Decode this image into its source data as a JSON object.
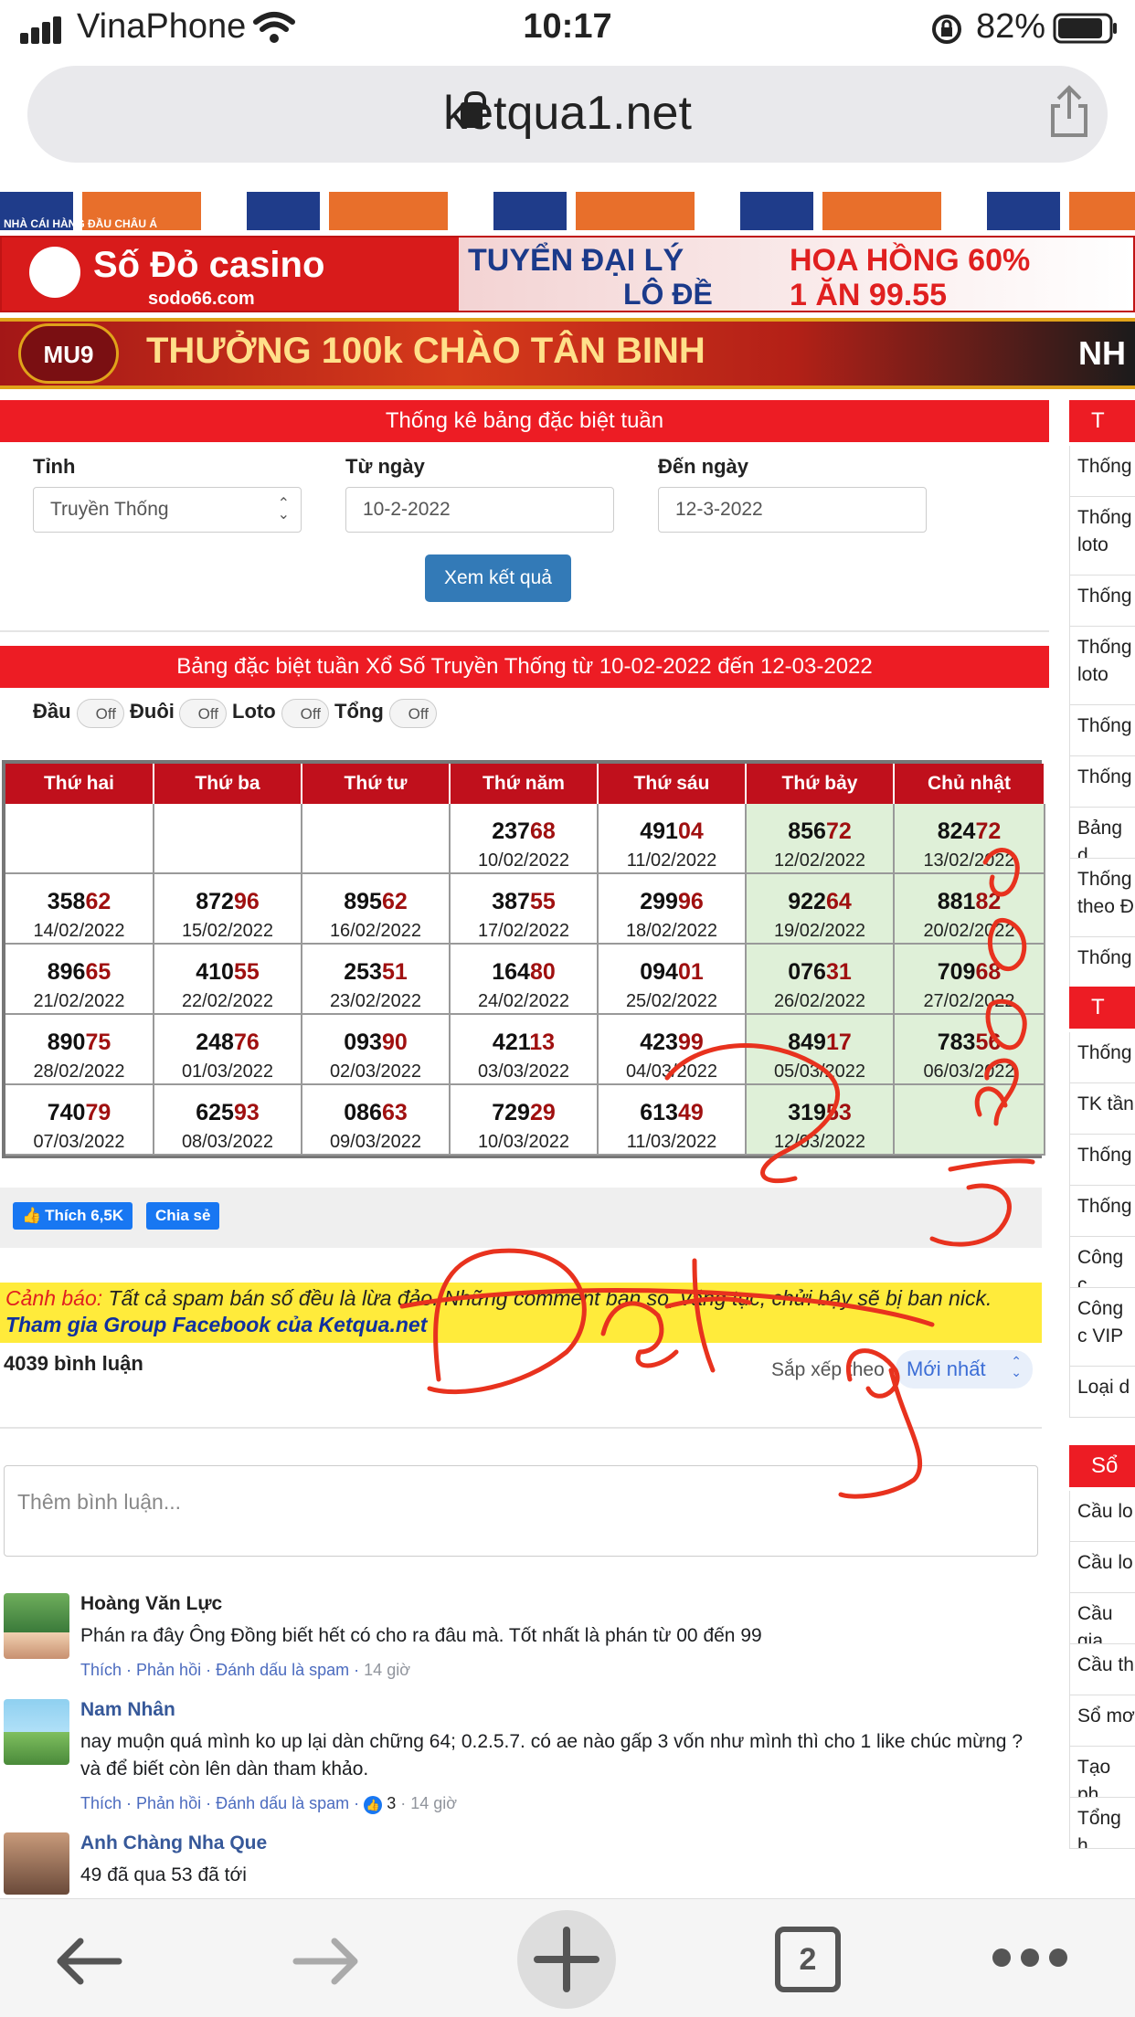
{
  "status_bar": {
    "carrier": "VinaPhone",
    "time": "10:17",
    "battery": "82%"
  },
  "browser": {
    "url": "ketqua1.net",
    "tab_count": "2"
  },
  "banners": {
    "b1_text": "NHÀ CÁI HÀNG ĐẦU CHÂU Á",
    "b2_brand": "Số Đỏ casino",
    "b2_site": "sodo66.com",
    "b2_line1": "TUYỂN ĐẠI LÝ",
    "b2_line2": "LÔ ĐỀ",
    "b2_line3": "HOA HỒNG 60%",
    "b2_line4": "1 ĂN 99.55",
    "b3_brand": "MU9",
    "b3_text": "THƯỞNG 100k CHÀO TÂN BINH",
    "b3_tail": "NH"
  },
  "filter": {
    "title": "Thống kê bảng đặc biệt tuần",
    "province_label": "Tỉnh",
    "province_value": "Truyền Thống",
    "from_label": "Từ ngày",
    "from_value": "10-2-2022",
    "to_label": "Đến ngày",
    "to_value": "12-3-2022",
    "submit": "Xem kết quả"
  },
  "results": {
    "title": "Bảng đặc biệt tuần Xổ Số Truyền Thống từ 10-02-2022 đến 12-03-2022",
    "toggles": [
      {
        "label": "Đầu",
        "state": "Off"
      },
      {
        "label": "Đuôi",
        "state": "Off"
      },
      {
        "label": "Loto",
        "state": "Off"
      },
      {
        "label": "Tổng",
        "state": "Off"
      }
    ],
    "headers": [
      "Thứ hai",
      "Thứ ba",
      "Thứ tư",
      "Thứ năm",
      "Thứ sáu",
      "Thứ bảy",
      "Chủ nhật"
    ],
    "rows": [
      [
        {
          "a": "",
          "b": "",
          "d": ""
        },
        {
          "a": "",
          "b": "",
          "d": ""
        },
        {
          "a": "",
          "b": "",
          "d": ""
        },
        {
          "a": "237",
          "b": "68",
          "d": "10/02/2022"
        },
        {
          "a": "491",
          "b": "04",
          "d": "11/02/2022"
        },
        {
          "a": "856",
          "b": "72",
          "d": "12/02/2022"
        },
        {
          "a": "824",
          "b": "72",
          "d": "13/02/2022"
        }
      ],
      [
        {
          "a": "358",
          "b": "62",
          "d": "14/02/2022"
        },
        {
          "a": "872",
          "b": "96",
          "d": "15/02/2022"
        },
        {
          "a": "895",
          "b": "62",
          "d": "16/02/2022"
        },
        {
          "a": "387",
          "b": "55",
          "d": "17/02/2022"
        },
        {
          "a": "299",
          "b": "96",
          "d": "18/02/2022"
        },
        {
          "a": "922",
          "b": "64",
          "d": "19/02/2022"
        },
        {
          "a": "881",
          "b": "82",
          "d": "20/02/2022"
        }
      ],
      [
        {
          "a": "896",
          "b": "65",
          "d": "21/02/2022"
        },
        {
          "a": "410",
          "b": "55",
          "d": "22/02/2022"
        },
        {
          "a": "253",
          "b": "51",
          "d": "23/02/2022"
        },
        {
          "a": "164",
          "b": "80",
          "d": "24/02/2022"
        },
        {
          "a": "094",
          "b": "01",
          "d": "25/02/2022"
        },
        {
          "a": "076",
          "b": "31",
          "d": "26/02/2022"
        },
        {
          "a": "709",
          "b": "68",
          "d": "27/02/2022"
        }
      ],
      [
        {
          "a": "890",
          "b": "75",
          "d": "28/02/2022"
        },
        {
          "a": "248",
          "b": "76",
          "d": "01/03/2022"
        },
        {
          "a": "093",
          "b": "90",
          "d": "02/03/2022"
        },
        {
          "a": "421",
          "b": "13",
          "d": "03/03/2022"
        },
        {
          "a": "423",
          "b": "99",
          "d": "04/03/2022"
        },
        {
          "a": "849",
          "b": "17",
          "d": "05/03/2022"
        },
        {
          "a": "783",
          "b": "56",
          "d": "06/03/2022"
        }
      ],
      [
        {
          "a": "740",
          "b": "79",
          "d": "07/03/2022"
        },
        {
          "a": "625",
          "b": "93",
          "d": "08/03/2022"
        },
        {
          "a": "086",
          "b": "63",
          "d": "09/03/2022"
        },
        {
          "a": "729",
          "b": "29",
          "d": "10/03/2022"
        },
        {
          "a": "613",
          "b": "49",
          "d": "11/03/2022"
        },
        {
          "a": "319",
          "b": "53",
          "d": "12/03/2022"
        },
        {
          "a": "",
          "b": "",
          "d": ""
        }
      ]
    ]
  },
  "social": {
    "like": "Thích 6,5K",
    "share": "Chia sẻ"
  },
  "warning": {
    "head": "Cảnh báo:",
    "text": " Tất cả spam bán số đều là lừa đảo. Những comment bán số, văng tục, chửi bậy sẽ bị ban nick.",
    "link": "Tham gia Group Facebook của Ketqua.net"
  },
  "comments": {
    "count": "4039 bình luận",
    "sort_label": "Sắp xếp theo",
    "sort_value": "Mới nhất",
    "placeholder": "Thêm bình luận...",
    "items": [
      {
        "name": "Hoàng Văn Lực",
        "text": "Phán ra đây Ông Đồng biết hết có cho ra đâu mà. Tốt nhất là phán từ 00 đến 99",
        "actions": "Thích · Phản hồi · Đánh dấu là spam · ",
        "time": "14 giờ"
      },
      {
        "name": "Nam Nhân",
        "text": "nay muộn quá mình ko up lại dàn chững 64; 0.2.5.7. có ae nào gấp 3 vốn như mình thì cho 1 like chúc mừng ? và để biết còn lên dàn tham khảo.",
        "actions": "Thích · Phản hồi · Đánh dấu là spam · ",
        "likes": "3",
        "time": "14 giờ"
      },
      {
        "name": "Anh Chàng Nha Que",
        "text": "49 đã qua 53 đã tới"
      }
    ]
  },
  "sidebar": {
    "sections": [
      {
        "head": "T",
        "items": [
          "Thống",
          "Thống loto",
          "Thống",
          "Thống loto",
          "Thống",
          "Thống",
          "Bảng d",
          "Thống theo Đ",
          "Thống"
        ]
      },
      {
        "head": "T",
        "items": [
          "Thống",
          "TK tần",
          "Thống",
          "Thống",
          "Công c",
          "Công c VIP",
          "Loại d"
        ]
      },
      {
        "head": "Sổ",
        "items": [
          "Cầu lo",
          "Cầu lo",
          "Cầu gia",
          "Cầu th",
          "Sổ mơ",
          "Tạo ph",
          "Tổng h"
        ]
      }
    ]
  },
  "colors": {
    "accent_red": "#ed1c24",
    "header_red": "#c0101c",
    "weekend_green": "#dff0d8",
    "button_blue": "#337ab7",
    "facebook_blue": "#1877f2",
    "warning_yellow": "#ffeb3b"
  }
}
